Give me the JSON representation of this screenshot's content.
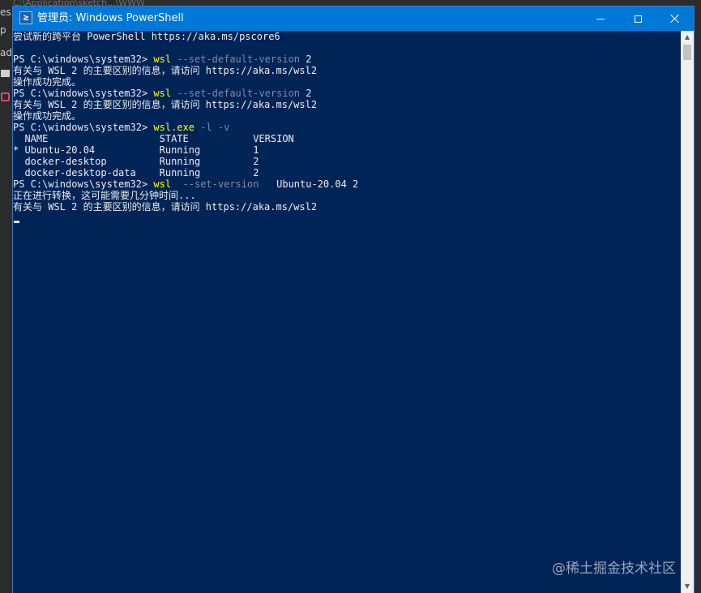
{
  "background": {
    "left_fragments": [
      "es",
      "p",
      "ad"
    ],
    "top_strip_text": "C:\\Application\\sketch...\\WWW"
  },
  "window": {
    "title": "管理员: Windows PowerShell",
    "icon_glyph": "≥",
    "controls": {
      "minimize_icon": "minimize-icon",
      "maximize_icon": "maximize-icon",
      "close_icon": "close-icon"
    },
    "colors": {
      "titlebar": "#0078d7",
      "console_bg": "#012456",
      "console_fg": "#eeedf0",
      "command_fg": "#fefe00",
      "param_fg": "#7f8aa6"
    }
  },
  "console": {
    "line0": "尝试新的跨平台 PowerShell https://aka.ms/pscore6",
    "prompt": "PS C:\\windows\\system32> ",
    "cmd_wsl": "wsl",
    "param_default_version": " --set-default-version",
    "arg_2": " 2",
    "info_wsl2": "有关与 WSL 2 的主要区别的信息，请访问 https://aka.ms/wsl2",
    "success": "操作成功完成。",
    "cmd_wsl_exe": "wsl.exe",
    "param_lv": " -l -v",
    "table_header": "  NAME                   STATE           VERSION",
    "rows": [
      "* Ubuntu-20.04           Running         1",
      "  docker-desktop         Running         2",
      "  docker-desktop-data    Running         2"
    ],
    "param_set_version": "  --set-version",
    "arg_ubuntu": "   Ubuntu-20.04 2",
    "converting": "正在进行转换，这可能需要几分钟时间..."
  },
  "scrollbar": {
    "up_icon": "scroll-up-arrow-icon",
    "down_icon": "scroll-down-arrow-icon",
    "up_glyph": "▲",
    "down_glyph": "▼"
  },
  "watermark": "@稀土掘金技术社区"
}
